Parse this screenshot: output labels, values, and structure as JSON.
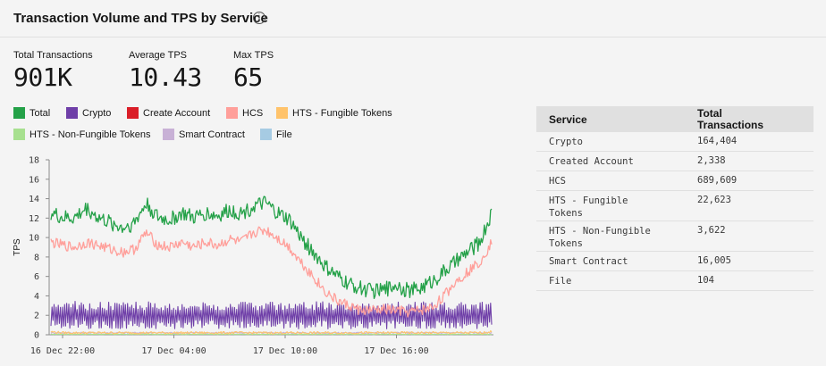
{
  "header": {
    "title": "Transaction Volume and TPS by Service",
    "info_icon": "info-icon",
    "info_glyph": "i"
  },
  "kpis": [
    {
      "label": "Total Transactions",
      "value": "901K"
    },
    {
      "label": "Average TPS",
      "value": "10.43"
    },
    {
      "label": "Max TPS",
      "value": "65"
    }
  ],
  "legend": [
    {
      "label": "Total",
      "color": "#24a148"
    },
    {
      "label": "Crypto",
      "color": "#6f3fa8"
    },
    {
      "label": "Create Account",
      "color": "#da1e28"
    },
    {
      "label": "HCS",
      "color": "#ff9f9a"
    },
    {
      "label": "HTS - Fungible Tokens",
      "color": "#ffc36b"
    },
    {
      "label": "HTS - Non-Fungible Tokens",
      "color": "#a7e08f"
    },
    {
      "label": "Smart Contract",
      "color": "#c8b1d6"
    },
    {
      "label": "File",
      "color": "#a6cbe3"
    }
  ],
  "table": {
    "headers": {
      "service": "Service",
      "total_line1": "Total",
      "total_line2": "Transactions"
    },
    "rows": [
      {
        "service": "Crypto",
        "service2": "",
        "total": "164,404"
      },
      {
        "service": "Created Account",
        "service2": "",
        "total": "2,338"
      },
      {
        "service": "HCS",
        "service2": "",
        "total": "689,609"
      },
      {
        "service": "HTS - Fungible",
        "service2": "Tokens",
        "total": "22,623"
      },
      {
        "service": "HTS - Non-Fungible",
        "service2": "Tokens",
        "total": "3,622"
      },
      {
        "service": "Smart Contract",
        "service2": "",
        "total": "16,005"
      },
      {
        "service": "File",
        "service2": "",
        "total": "104"
      }
    ]
  },
  "chart_data": {
    "type": "line",
    "ylabel": "TPS",
    "xlabel": "",
    "ylim": [
      0,
      18
    ],
    "yticks": [
      0,
      2,
      4,
      6,
      8,
      10,
      12,
      14,
      16,
      18
    ],
    "xticks": [
      "16 Dec 22:00",
      "17 Dec 04:00",
      "17 Dec 10:00",
      "17 Dec 16:00"
    ],
    "x_hours": [
      0,
      3,
      6,
      9,
      12,
      15,
      18,
      21,
      24
    ],
    "series": [
      {
        "name": "Total",
        "color": "#24a148",
        "values": [
          12.5,
          12.0,
          12.0,
          13.0,
          12.0,
          11.5,
          11.0,
          11.5,
          13.5,
          12.0,
          11.8,
          12.5,
          12.0,
          12.5,
          12.2,
          12.8,
          12.5,
          13.2,
          13.5,
          12.5,
          11.8,
          10.0,
          8.5,
          7.0,
          6.0,
          5.2,
          4.8,
          4.5,
          4.6,
          5.2,
          4.5,
          4.8,
          5.5,
          6.5,
          7.5,
          8.5,
          9.5,
          12.5
        ]
      },
      {
        "name": "HCS",
        "color": "#ff9f9a",
        "values": [
          9.5,
          9.2,
          9.0,
          9.5,
          9.2,
          8.8,
          8.5,
          8.8,
          10.5,
          9.2,
          9.0,
          9.5,
          9.0,
          9.5,
          9.2,
          9.8,
          9.5,
          10.5,
          10.8,
          10.0,
          9.0,
          7.5,
          6.0,
          4.5,
          3.5,
          3.0,
          2.5,
          2.5,
          2.6,
          2.5,
          2.3,
          2.5,
          2.8,
          4.0,
          5.5,
          6.5,
          7.5,
          9.5
        ]
      },
      {
        "name": "Crypto",
        "color": "#6f3fa8",
        "values": [
          2.0,
          2.0,
          2.1,
          2.0,
          2.0,
          2.0,
          2.0,
          2.0,
          2.0,
          2.0,
          2.0,
          2.0,
          2.0,
          2.0,
          2.0,
          2.0,
          2.0,
          2.0,
          2.0,
          2.0,
          2.0,
          2.0,
          2.0,
          2.0,
          2.0,
          2.0,
          2.0,
          2.0,
          2.0,
          2.0,
          2.0,
          2.0,
          2.0,
          2.0,
          2.0,
          2.0,
          2.0,
          2.0
        ]
      },
      {
        "name": "HTS - Fungible Tokens",
        "color": "#ffc36b",
        "values": [
          0.3,
          0.2,
          0.2,
          0.2,
          0.2,
          0.2,
          0.2,
          0.2,
          0.2,
          0.2,
          0.2,
          0.2,
          0.2,
          0.2,
          0.2,
          0.2,
          0.2,
          0.2,
          0.2,
          0.2,
          0.2,
          0.2,
          0.2,
          0.2,
          0.2,
          0.2,
          0.2,
          0.2,
          0.2,
          0.2,
          0.2,
          0.2,
          0.2,
          0.2,
          0.2,
          0.2,
          0.2,
          0.3
        ]
      },
      {
        "name": "Smart Contract",
        "color": "#c8b1d6",
        "values": [
          0.2,
          0.2,
          0.2,
          0.2,
          0.2,
          0.2,
          0.2,
          0.2,
          0.2,
          0.2,
          0.2,
          0.2,
          0.2,
          0.2,
          0.2,
          0.2,
          0.2,
          0.2,
          0.2,
          0.2,
          0.2,
          0.2,
          0.2,
          0.2,
          0.2,
          0.2,
          0.2,
          0.2,
          0.2,
          0.2,
          0.2,
          0.2,
          0.2,
          0.2,
          0.2,
          0.2,
          0.2,
          0.2
        ]
      },
      {
        "name": "HTS - Non-Fungible Tokens",
        "color": "#a7e08f",
        "values": [
          0.05,
          0.05,
          0.05,
          0.05,
          0.05,
          0.05,
          0.05,
          0.05,
          0.05,
          0.05,
          0.05,
          0.05,
          0.05,
          0.05,
          0.05,
          0.05,
          0.05,
          0.05,
          0.05,
          0.05,
          0.05,
          0.05,
          0.05,
          0.05,
          0.05,
          0.05,
          0.05,
          0.05,
          0.05,
          0.05,
          0.05,
          0.05,
          0.05,
          0.05,
          0.05,
          0.05,
          0.05,
          0.05
        ]
      }
    ]
  }
}
